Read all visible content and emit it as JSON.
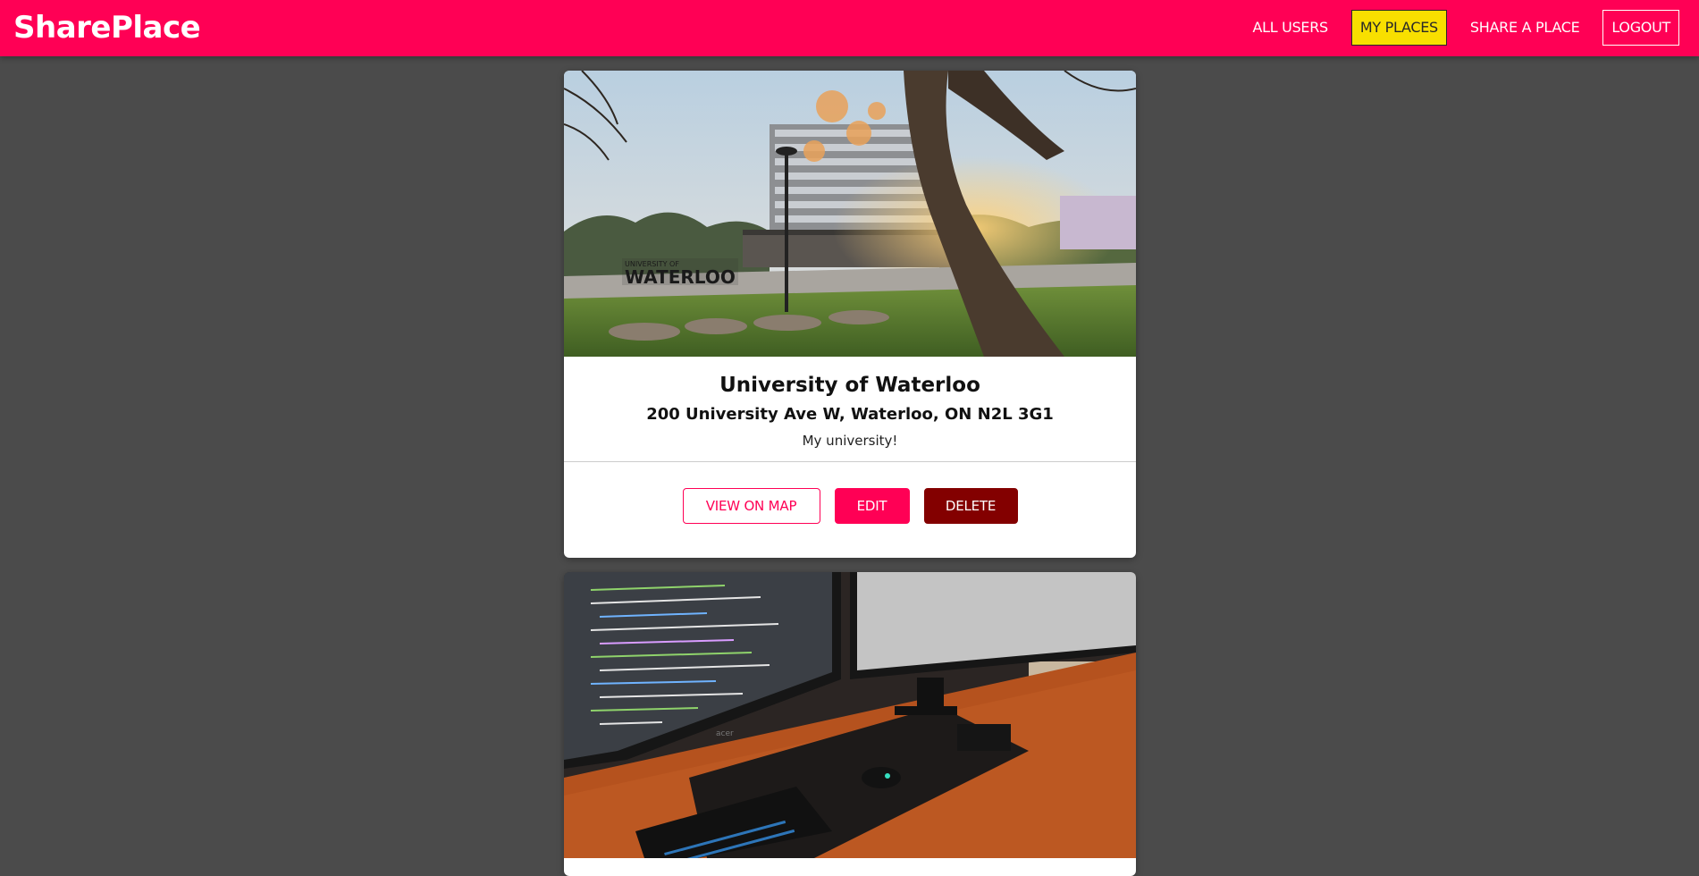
{
  "header": {
    "brand": "SharePlace",
    "nav": {
      "all_users": "ALL USERS",
      "my_places": "MY PLACES",
      "share_place": "SHARE A PLACE",
      "logout": "LOGOUT"
    }
  },
  "places": [
    {
      "title": "University of Waterloo",
      "address": "200 University Ave W, Waterloo, ON N2L 3G1",
      "description": "My university!",
      "sign_text": "WATERLOO",
      "sign_small": "UNIVERSITY OF",
      "actions": {
        "view_on_map": "VIEW ON MAP",
        "edit": "EDIT",
        "delete": "DELETE"
      }
    },
    {
      "monitor_brand": "acer"
    }
  ],
  "colors": {
    "brand": "#ff0055",
    "active_nav": "#f8df00",
    "danger": "#830000",
    "background": "#4b4b4b"
  }
}
